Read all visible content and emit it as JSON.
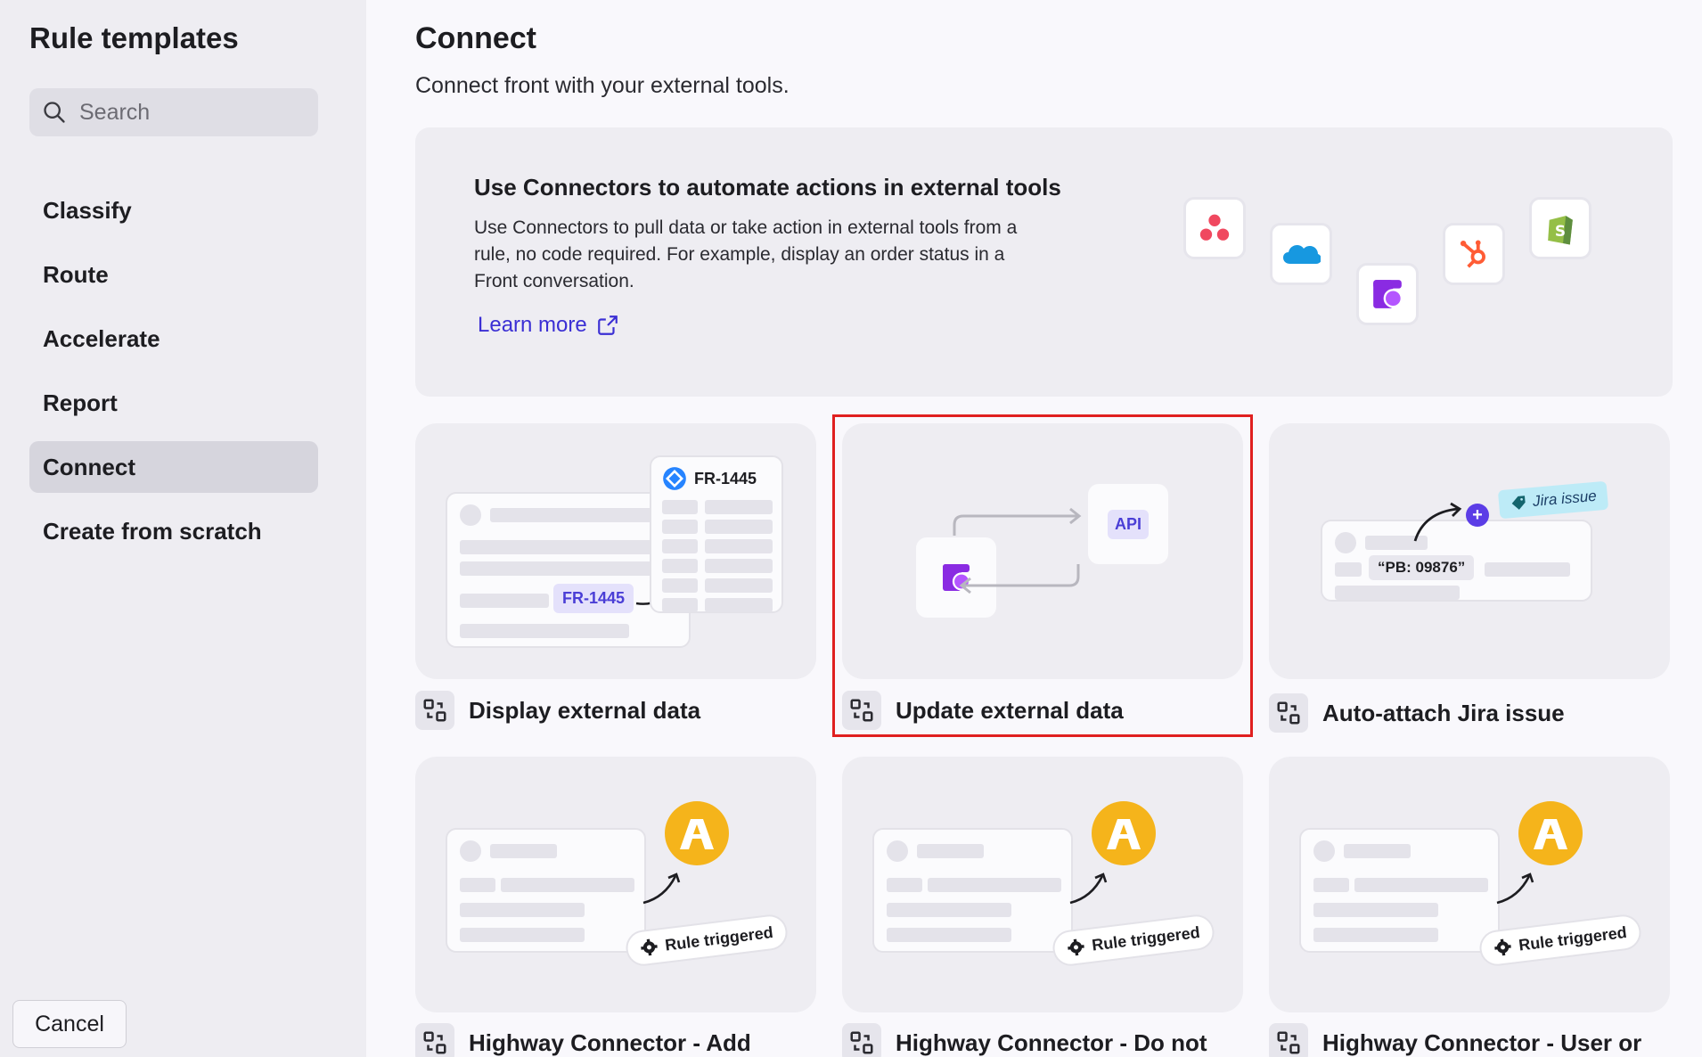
{
  "sidebar": {
    "title": "Rule templates",
    "search_placeholder": "Search",
    "items": [
      {
        "label": "Classify",
        "active": false
      },
      {
        "label": "Route",
        "active": false
      },
      {
        "label": "Accelerate",
        "active": false
      },
      {
        "label": "Report",
        "active": false
      },
      {
        "label": "Connect",
        "active": true
      },
      {
        "label": "Create from scratch",
        "active": false
      }
    ],
    "cancel_label": "Cancel"
  },
  "main": {
    "title": "Connect",
    "subtitle": "Connect front with your external tools.",
    "banner": {
      "title": "Use Connectors to automate actions in external tools",
      "description": "Use Connectors to pull data or take action in external tools from a rule, no code required. For example, display an order status in a Front conversation.",
      "learn_more": "Learn more",
      "app_icons": [
        "asana-icon",
        "salesforce-icon",
        "front-icon",
        "hubspot-icon",
        "shopify-icon"
      ]
    },
    "cards": [
      {
        "label": "Display external data",
        "ticket": "FR-1445",
        "tag": "FR-1445"
      },
      {
        "label": "Update external data",
        "api": "API",
        "selected": true
      },
      {
        "label": "Auto-attach Jira issue",
        "badge": "Jira issue",
        "code": "“PB: 09876”"
      },
      {
        "label": "Highway Connector - Add",
        "pill": "Rule triggered"
      },
      {
        "label": "Highway Connector - Do not",
        "pill": "Rule triggered"
      },
      {
        "label": "Highway Connector - User or",
        "pill": "Rule triggered"
      }
    ]
  },
  "colors": {
    "accent": "#3b2fd4",
    "front_purple": "#8a2be2",
    "highway_yellow": "#f5b41b",
    "selection_red": "#e01f1f"
  }
}
